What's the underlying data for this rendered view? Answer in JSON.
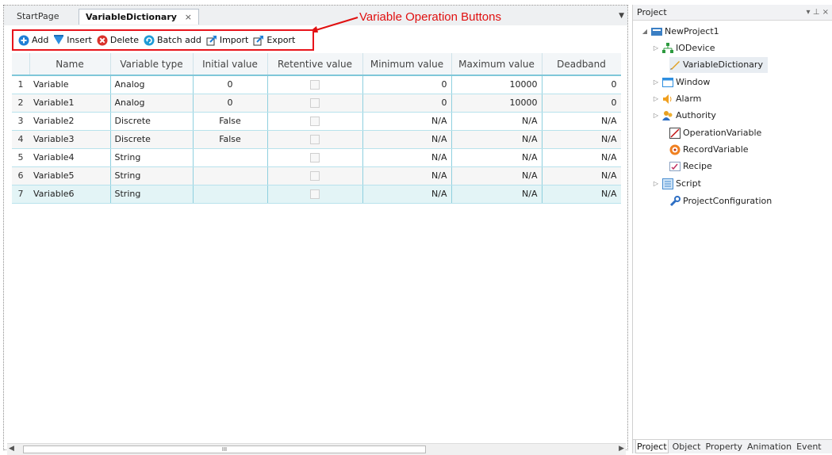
{
  "tabs": [
    {
      "label": "StartPage"
    },
    {
      "label": "VariableDictionary",
      "close": "×"
    }
  ],
  "annotation": {
    "text": "Variable Operation Buttons",
    "color": "#e01010"
  },
  "toolbar": {
    "add": "Add",
    "insert": "Insert",
    "delete": "Delete",
    "batch_add": "Batch add",
    "import": "Import",
    "export": "Export"
  },
  "grid": {
    "columns": [
      "Name",
      "Variable type",
      "Initial value",
      "Retentive value",
      "Minimum value",
      "Maximum value",
      "Deadband"
    ],
    "rows": [
      {
        "n": "1",
        "name": "Variable",
        "type": "Analog",
        "init": "0",
        "min": "0",
        "max": "10000",
        "dead": "0"
      },
      {
        "n": "2",
        "name": "Variable1",
        "type": "Analog",
        "init": "0",
        "min": "0",
        "max": "10000",
        "dead": "0"
      },
      {
        "n": "3",
        "name": "Variable2",
        "type": "Discrete",
        "init": "False",
        "min": "N/A",
        "max": "N/A",
        "dead": "N/A"
      },
      {
        "n": "4",
        "name": "Variable3",
        "type": "Discrete",
        "init": "False",
        "min": "N/A",
        "max": "N/A",
        "dead": "N/A"
      },
      {
        "n": "5",
        "name": "Variable4",
        "type": "String",
        "init": "",
        "min": "N/A",
        "max": "N/A",
        "dead": "N/A"
      },
      {
        "n": "6",
        "name": "Variable5",
        "type": "String",
        "init": "",
        "min": "N/A",
        "max": "N/A",
        "dead": "N/A"
      },
      {
        "n": "7",
        "name": "Variable6",
        "type": "String",
        "init": "",
        "min": "N/A",
        "max": "N/A",
        "dead": "N/A"
      }
    ]
  },
  "scrollbar": {
    "thumb_label": "III"
  },
  "right_panel": {
    "title": "Project",
    "controls": "▾ ⊥ ×",
    "tree": {
      "root": "NewProject1",
      "io_device": "IODevice",
      "variable_dictionary": "VariableDictionary",
      "window": "Window",
      "alarm": "Alarm",
      "authority": "Authority",
      "operation_variable": "OperationVariable",
      "record_variable": "RecordVariable",
      "recipe": "Recipe",
      "script": "Script",
      "project_configuration": "ProjectConfiguration"
    },
    "bottom_tabs": [
      "Project",
      "Object",
      "Property",
      "Animation",
      "Event"
    ]
  },
  "colors": {
    "annotation_red": "#e01010",
    "toolbar_outline": "#e8141b",
    "grid_line": "#8fd0df",
    "selected_row": "#e3f4f6"
  },
  "icons": {
    "add": "plus-circle-icon",
    "insert": "insert-arrow-icon",
    "delete": "delete-x-icon",
    "batch_add": "batch-add-icon",
    "import": "import-icon",
    "export": "export-icon"
  }
}
